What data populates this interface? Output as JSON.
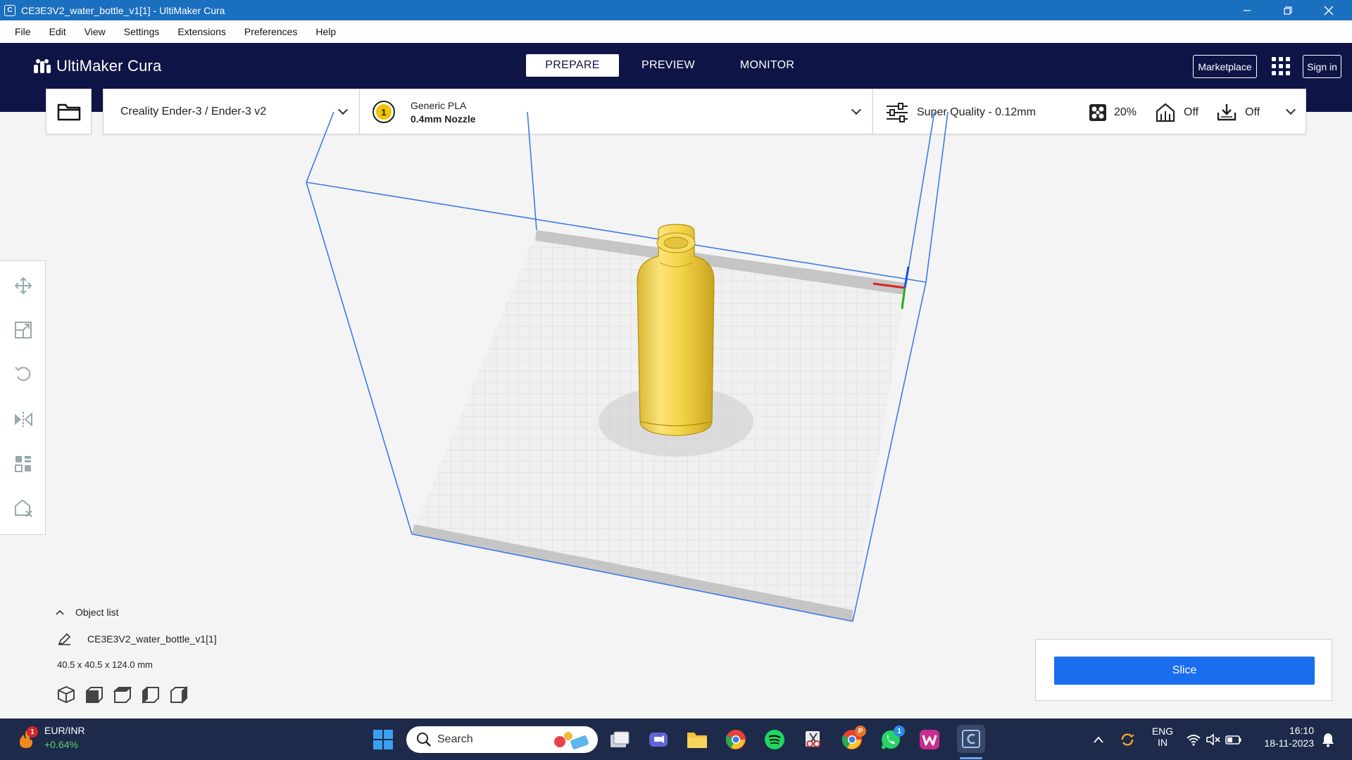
{
  "window": {
    "title": "CE3E3V2_water_bottle_v1[1] - UltiMaker Cura",
    "app_icon": "C"
  },
  "menu": [
    "File",
    "Edit",
    "View",
    "Settings",
    "Extensions",
    "Preferences",
    "Help"
  ],
  "header": {
    "logo_text": "UltiMaker Cura",
    "stages": [
      "PREPARE",
      "PREVIEW",
      "MONITOR"
    ],
    "active_stage": "PREPARE",
    "marketplace_label": "Marketplace",
    "signin_label": "Sign in"
  },
  "toolbar": {
    "machine": "Creality Ender-3 / Ender-3 v2",
    "extruder_number": "1",
    "material_name": "Generic PLA",
    "nozzle": "0.4mm Nozzle",
    "quality": "Super Quality - 0.12mm",
    "infill": "20%",
    "support": "Off",
    "adhesion": "Off"
  },
  "tools": [
    "move-icon",
    "scale-icon",
    "rotate-icon",
    "mirror-icon",
    "per-model-settings-icon",
    "support-blocker-icon"
  ],
  "object_list": {
    "header": "Object list",
    "object_name": "CE3E3V2_water_bottle_v1[1]",
    "dimensions": "40.5 x 40.5 x 124.0 mm"
  },
  "slice": {
    "button_label": "Slice"
  },
  "taskbar": {
    "ticker_name": "EUR/INR",
    "ticker_change": "+0.64%",
    "ticker_badge": "1",
    "search_placeholder": "Search",
    "lang_top": "ENG",
    "lang_bottom": "IN",
    "time": "16:10",
    "date": "18-11-2023",
    "chrome_badge": "P",
    "whatsapp_badge": "1"
  },
  "colors": {
    "header_bg": "#0f1446",
    "accent": "#196ef0",
    "titlebar": "#1b6fbf",
    "model": "#f5d64a",
    "taskbar": "#1e2a4a"
  }
}
